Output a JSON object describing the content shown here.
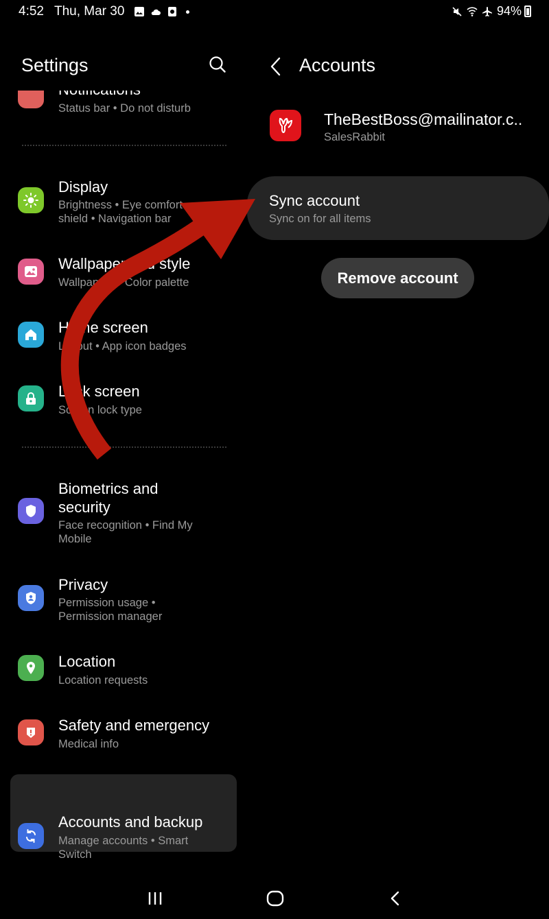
{
  "status_bar": {
    "time": "4:52",
    "date": "Thu, Mar 30",
    "battery": "94%"
  },
  "left_pane": {
    "title": "Settings",
    "items": [
      {
        "title": "Notifications",
        "subtitle": "Status bar  •  Do not disturb",
        "icon": "notification-icon",
        "color": "#e0605c"
      },
      {
        "title": "Display",
        "subtitle": "Brightness  •  Eye comfort shield  •  Navigation bar",
        "icon": "sun-icon",
        "color": "#7ec82a"
      },
      {
        "title": "Wallpaper and style",
        "subtitle": "Wallpapers  •  Color palette",
        "icon": "image-icon",
        "color": "#e05c8a"
      },
      {
        "title": "Home screen",
        "subtitle": "Layout  •  App icon badges",
        "icon": "home-icon",
        "color": "#2aa8d8"
      },
      {
        "title": "Lock screen",
        "subtitle": "Screen lock type",
        "icon": "lock-icon",
        "color": "#25b28a"
      },
      {
        "title": "Biometrics and security",
        "subtitle": "Face recognition  •  Find My Mobile",
        "icon": "shield-icon",
        "color": "#6a62e0"
      },
      {
        "title": "Privacy",
        "subtitle": "Permission usage  •  Permission manager",
        "icon": "privacy-icon",
        "color": "#4a7ae0"
      },
      {
        "title": "Location",
        "subtitle": "Location requests",
        "icon": "location-pin-icon",
        "color": "#4caf50"
      },
      {
        "title": "Safety and emergency",
        "subtitle": "Medical info",
        "icon": "alert-icon",
        "color": "#e0554a"
      },
      {
        "title": "Accounts and backup",
        "subtitle": "Manage accounts  •  Smart Switch",
        "icon": "sync-icon",
        "color": "#3d6ee0"
      }
    ]
  },
  "right_pane": {
    "title": "Accounts",
    "account": {
      "email": "TheBestBoss@mailinator.c..",
      "app": "SalesRabbit"
    },
    "sync": {
      "title": "Sync account",
      "subtitle": "Sync on for all items"
    },
    "remove_label": "Remove account"
  },
  "annotation": {
    "color": "#b81a0c"
  }
}
